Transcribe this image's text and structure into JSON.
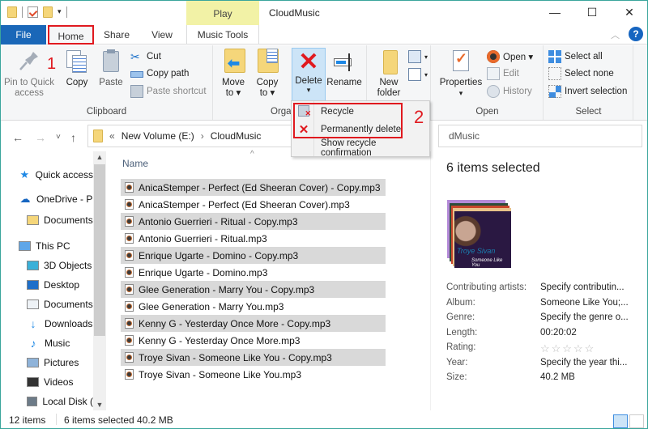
{
  "titlebar": {
    "title": "CloudMusic",
    "contextual_tab": "Play",
    "minimize": "—",
    "maximize": "☐",
    "close": "✕"
  },
  "tabs": {
    "file": "File",
    "home": "Home",
    "share": "Share",
    "view": "View",
    "music_tools": "Music Tools"
  },
  "ribbon": {
    "clipboard": {
      "label": "Clipboard",
      "pin": "Pin to Quick access",
      "pin_line1": "Pin to Quick",
      "pin_line2": "access",
      "copy": "Copy",
      "paste": "Paste",
      "cut": "Cut",
      "copy_path": "Copy path",
      "paste_shortcut": "Paste shortcut"
    },
    "organize": {
      "label": "Orga",
      "move_to_1": "Move",
      "move_to_2": "to ▾",
      "copy_to_1": "Copy",
      "copy_to_2": "to ▾",
      "delete": "Delete",
      "delete_caret": "▾",
      "rename": "Rename"
    },
    "new": {
      "new_folder_1": "New",
      "new_folder_2": "folder"
    },
    "open": {
      "label": "Open",
      "properties": "Properties",
      "properties_caret": "▾",
      "open": "Open ▾",
      "edit": "Edit",
      "history": "History"
    },
    "select": {
      "label": "Select",
      "select_all": "Select all",
      "select_none": "Select none",
      "invert": "Invert selection"
    }
  },
  "annotations": {
    "step1": "1",
    "step2": "2",
    "highlight_color": "#e0191f"
  },
  "delete_menu": {
    "items": [
      {
        "label": "Recycle",
        "icon": "recycle-bin-icon"
      },
      {
        "label": "Permanently delete",
        "icon": "red-x-icon"
      },
      {
        "label": "Show recycle confirmation",
        "icon": ""
      }
    ]
  },
  "address": {
    "prefix": "«",
    "path": [
      "New Volume (E:)",
      "CloudMusic"
    ],
    "separator": "›",
    "search_partial": "dMusic"
  },
  "sidebar": {
    "items": [
      {
        "label": "Quick access",
        "icon": "star-icon",
        "level": 0
      },
      {
        "label": "OneDrive - P",
        "icon": "cloud-icon",
        "level": 0
      },
      {
        "label": "Documents",
        "icon": "folder-icon",
        "level": 1
      },
      {
        "label": "This PC",
        "icon": "monitor-icon",
        "level": 0
      },
      {
        "label": "3D Objects",
        "icon": "cube-icon",
        "level": 1
      },
      {
        "label": "Desktop",
        "icon": "desktop-icon",
        "level": 1
      },
      {
        "label": "Documents",
        "icon": "document-icon",
        "level": 1
      },
      {
        "label": "Downloads",
        "icon": "download-arrow-icon",
        "level": 1
      },
      {
        "label": "Music",
        "icon": "music-note-icon",
        "level": 1
      },
      {
        "label": "Pictures",
        "icon": "picture-icon",
        "level": 1
      },
      {
        "label": "Videos",
        "icon": "film-icon",
        "level": 1
      },
      {
        "label": "Local Disk (",
        "icon": "drive-icon",
        "level": 1
      }
    ]
  },
  "filelist": {
    "column_name": "Name",
    "sort_caret": "^",
    "files": [
      {
        "name": "AnicaStemper - Perfect (Ed Sheeran Cover) - Copy.mp3",
        "selected": true
      },
      {
        "name": "AnicaStemper - Perfect (Ed Sheeran Cover).mp3",
        "selected": false
      },
      {
        "name": "Antonio Guerrieri - Ritual - Copy.mp3",
        "selected": true
      },
      {
        "name": "Antonio Guerrieri - Ritual.mp3",
        "selected": false
      },
      {
        "name": "Enrique Ugarte - Domino - Copy.mp3",
        "selected": true
      },
      {
        "name": "Enrique Ugarte - Domino.mp3",
        "selected": false
      },
      {
        "name": "Glee Generation - Marry You - Copy.mp3",
        "selected": true
      },
      {
        "name": "Glee Generation - Marry You.mp3",
        "selected": false
      },
      {
        "name": "Kenny G - Yesterday Once More - Copy.mp3",
        "selected": true
      },
      {
        "name": "Kenny G - Yesterday Once More.mp3",
        "selected": false
      },
      {
        "name": "Troye Sivan - Someone Like You - Copy.mp3",
        "selected": true
      },
      {
        "name": "Troye Sivan - Someone Like You.mp3",
        "selected": false
      }
    ]
  },
  "details": {
    "title": "6 items selected",
    "art_text1": "Troye Sivan",
    "art_text2": "Someone Like You",
    "properties": [
      {
        "label": "Contributing artists:",
        "value": "Specify contributin..."
      },
      {
        "label": "Album:",
        "value": "Someone Like You;..."
      },
      {
        "label": "Genre:",
        "value": "Specify the genre o..."
      },
      {
        "label": "Length:",
        "value": "00:20:02"
      },
      {
        "label": "Rating:",
        "value": "☆☆☆☆☆",
        "stars": 0
      },
      {
        "label": "Year:",
        "value": "Specify the year thi..."
      },
      {
        "label": "Size:",
        "value": "40.2 MB"
      }
    ]
  },
  "status": {
    "item_count": "12 items",
    "selection": "6 items selected  40.2 MB"
  }
}
